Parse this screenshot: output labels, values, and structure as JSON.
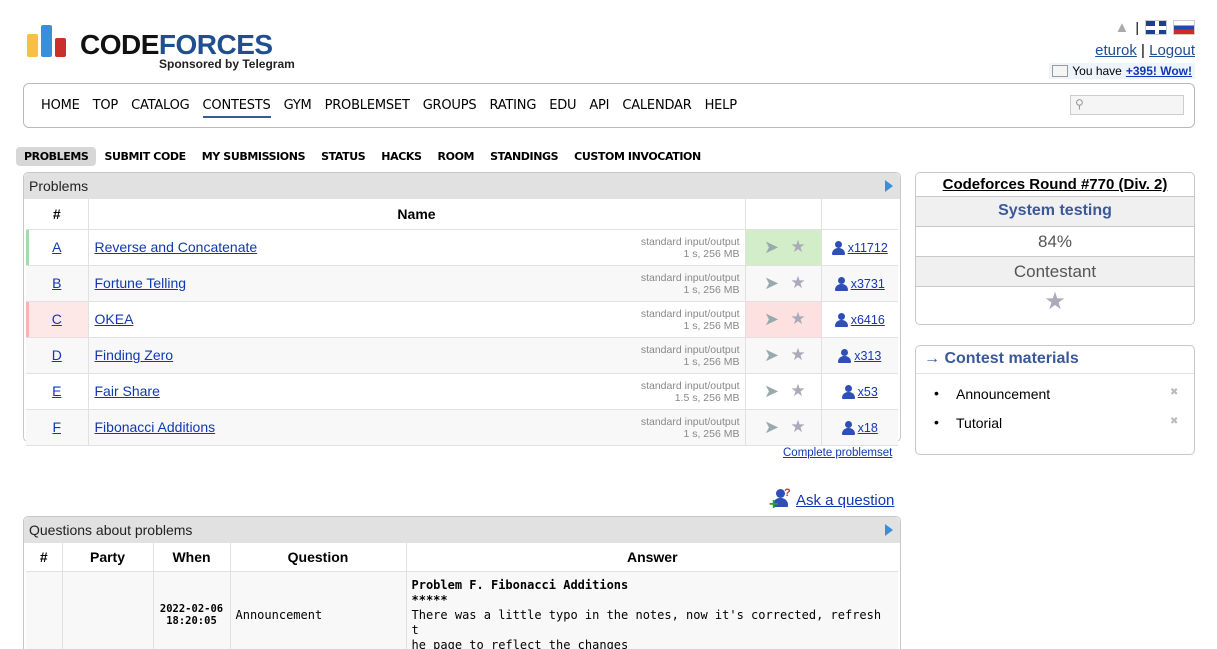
{
  "brand": {
    "name_black": "CODE",
    "name_blue": "FORCES",
    "sponsor": "Sponsored by Telegram",
    "colors": {
      "bar1": "#f6c142",
      "bar2": "#3b8fd9",
      "bar3": "#c9302c"
    }
  },
  "header": {
    "username": "eturok",
    "logout": "Logout",
    "separator": "|",
    "notify_prefix": "You have",
    "notify_link": "+395! Wow!"
  },
  "main_menu": [
    "HOME",
    "TOP",
    "CATALOG",
    "CONTESTS",
    "GYM",
    "PROBLEMSET",
    "GROUPS",
    "RATING",
    "EDU",
    "API",
    "CALENDAR",
    "HELP"
  ],
  "main_menu_active": "CONTESTS",
  "sub_menu": [
    "PROBLEMS",
    "SUBMIT CODE",
    "MY SUBMISSIONS",
    "STATUS",
    "HACKS",
    "ROOM",
    "STANDINGS",
    "CUSTOM INVOCATION"
  ],
  "sub_menu_active": "PROBLEMS",
  "problems": {
    "title": "Problems",
    "headers": {
      "idx": "#",
      "name": "Name"
    },
    "rows": [
      {
        "idx": "A",
        "name": "Reverse and Concatenate",
        "io": "standard input/output",
        "limits": "1 s, 256 MB",
        "solved": "x11712",
        "state": "accepted"
      },
      {
        "idx": "B",
        "name": "Fortune Telling",
        "io": "standard input/output",
        "limits": "1 s, 256 MB",
        "solved": "x3731",
        "state": "none"
      },
      {
        "idx": "C",
        "name": "OKEA",
        "io": "standard input/output",
        "limits": "1 s, 256 MB",
        "solved": "x6416",
        "state": "rejected"
      },
      {
        "idx": "D",
        "name": "Finding Zero",
        "io": "standard input/output",
        "limits": "1 s, 256 MB",
        "solved": "x313",
        "state": "none"
      },
      {
        "idx": "E",
        "name": "Fair Share",
        "io": "standard input/output",
        "limits": "1.5 s, 256 MB",
        "solved": "x53",
        "state": "none"
      },
      {
        "idx": "F",
        "name": "Fibonacci Additions",
        "io": "standard input/output",
        "limits": "1 s, 256 MB",
        "solved": "x18",
        "state": "none"
      }
    ],
    "complete_link": "Complete problemset"
  },
  "ask": {
    "label": "Ask a question"
  },
  "questions": {
    "title": "Questions about problems",
    "headers": {
      "idx": "#",
      "party": "Party",
      "when": "When",
      "question": "Question",
      "answer": "Answer"
    },
    "rows": [
      {
        "idx": "",
        "party": "",
        "when_date": "2022-02-06",
        "when_time": "18:20:05",
        "question": "Announcement",
        "answer_title": "Problem F. Fibonacci Additions",
        "answer_stars": "*****",
        "answer_line1": "There was a little typo in the notes, now it's corrected, refresh t",
        "answer_line2": "he page to reflect the changes"
      }
    ]
  },
  "sidebar": {
    "contest_name": "Codeforces Round #770 (Div. 2)",
    "phase": "System testing",
    "progress_text": "84%",
    "progress_value": 84,
    "role": "Contestant",
    "materials_title": "→ Contest materials",
    "materials": [
      "Announcement",
      "Tutorial"
    ]
  },
  "search": {
    "placeholder": ""
  }
}
